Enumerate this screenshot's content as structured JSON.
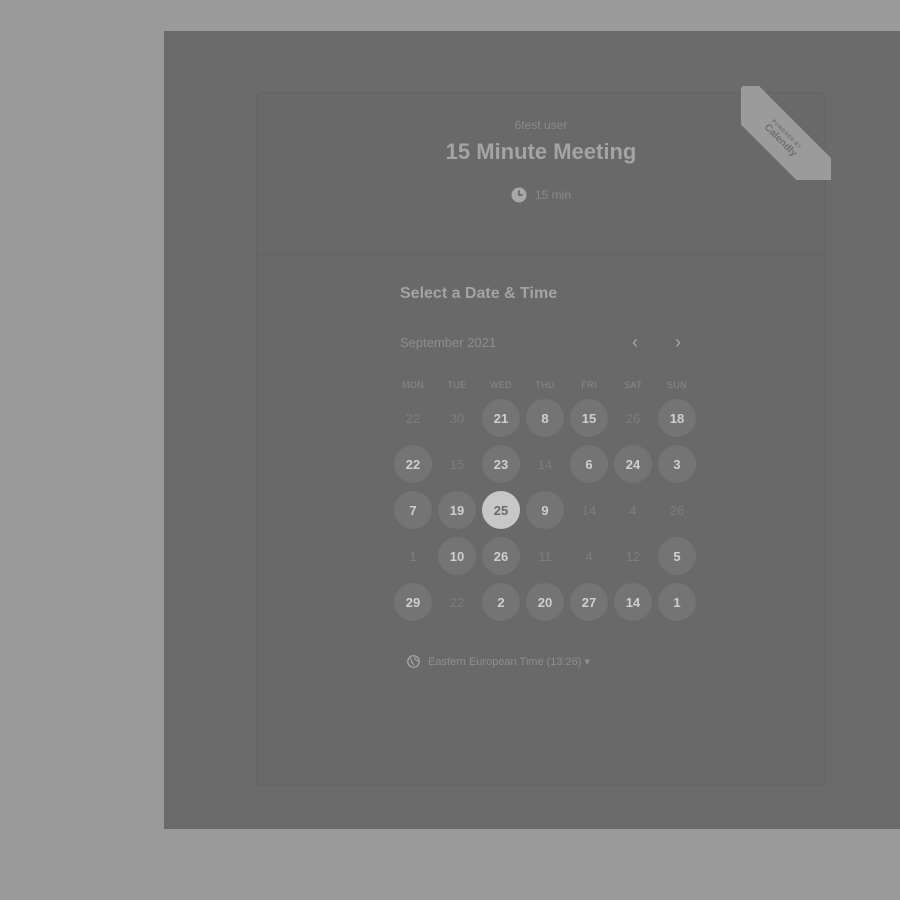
{
  "header": {
    "host": "6test user",
    "event_title": "15 Minute Meeting",
    "duration": "15 min"
  },
  "ribbon": {
    "small": "POWERED BY",
    "brand": "Calendly"
  },
  "picker": {
    "section_title": "Select a Date & Time",
    "month": "September 2021",
    "prev_symbol": "‹",
    "next_symbol": "›",
    "weekdays": [
      "MON",
      "TUE",
      "WED",
      "THU",
      "FRI",
      "SAT",
      "SUN"
    ],
    "weeks": [
      [
        {
          "label": "22",
          "state": "unavailable"
        },
        {
          "label": "30",
          "state": "unavailable"
        },
        {
          "label": "21",
          "state": "available"
        },
        {
          "label": "8",
          "state": "available"
        },
        {
          "label": "15",
          "state": "available"
        },
        {
          "label": "26",
          "state": "unavailable"
        },
        {
          "label": "18",
          "state": "available"
        }
      ],
      [
        {
          "label": "22",
          "state": "available"
        },
        {
          "label": "15",
          "state": "unavailable"
        },
        {
          "label": "23",
          "state": "available"
        },
        {
          "label": "14",
          "state": "unavailable"
        },
        {
          "label": "6",
          "state": "available"
        },
        {
          "label": "24",
          "state": "available"
        },
        {
          "label": "3",
          "state": "available"
        }
      ],
      [
        {
          "label": "7",
          "state": "available"
        },
        {
          "label": "19",
          "state": "available"
        },
        {
          "label": "25",
          "state": "selected"
        },
        {
          "label": "9",
          "state": "available"
        },
        {
          "label": "14",
          "state": "unavailable"
        },
        {
          "label": "4",
          "state": "unavailable"
        },
        {
          "label": "26",
          "state": "unavailable"
        }
      ],
      [
        {
          "label": "1",
          "state": "unavailable"
        },
        {
          "label": "10",
          "state": "available"
        },
        {
          "label": "26",
          "state": "available"
        },
        {
          "label": "11",
          "state": "unavailable"
        },
        {
          "label": "4",
          "state": "unavailable"
        },
        {
          "label": "12",
          "state": "unavailable"
        },
        {
          "label": "5",
          "state": "available"
        }
      ],
      [
        {
          "label": "29",
          "state": "available"
        },
        {
          "label": "22",
          "state": "unavailable"
        },
        {
          "label": "2",
          "state": "available"
        },
        {
          "label": "20",
          "state": "available"
        },
        {
          "label": "27",
          "state": "available"
        },
        {
          "label": "14",
          "state": "available"
        },
        {
          "label": "1",
          "state": "available"
        }
      ]
    ],
    "timezone": "Eastern European Time (13:26) ▾"
  },
  "icons": {
    "duration": "clock-icon",
    "timezone": "globe-icon",
    "prev": "chevron-left-icon",
    "next": "chevron-right-icon"
  },
  "colors": {
    "backdrop": "#9a9a9a",
    "overlay": "#6b6b6b",
    "selected_day": "#c7c7c7",
    "available_day": "#747474"
  }
}
